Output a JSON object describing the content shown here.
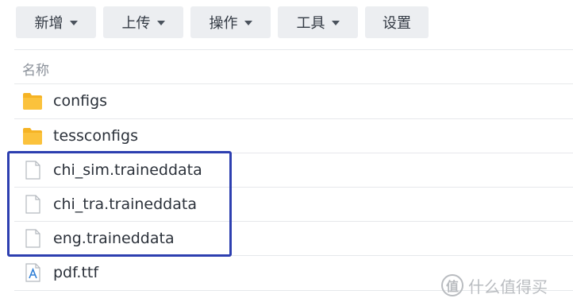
{
  "toolbar": {
    "create_label": "新增",
    "upload_label": "上传",
    "action_label": "操作",
    "tools_label": "工具",
    "settings_label": "设置"
  },
  "list": {
    "header_name": "名称",
    "items": [
      {
        "name": "configs",
        "icon": "folder-icon"
      },
      {
        "name": "tessconfigs",
        "icon": "folder-icon"
      },
      {
        "name": "chi_sim.traineddata",
        "icon": "file-icon"
      },
      {
        "name": "chi_tra.traineddata",
        "icon": "file-icon"
      },
      {
        "name": "eng.traineddata",
        "icon": "file-icon"
      },
      {
        "name": "pdf.ttf",
        "icon": "font-file-icon"
      }
    ]
  },
  "watermark": {
    "icon_glyph": "值",
    "text": "什么值得买"
  },
  "colors": {
    "folder": "#f5b324",
    "highlight_border": "#2d3fb0",
    "font_file_accent": "#2f7fd6"
  }
}
